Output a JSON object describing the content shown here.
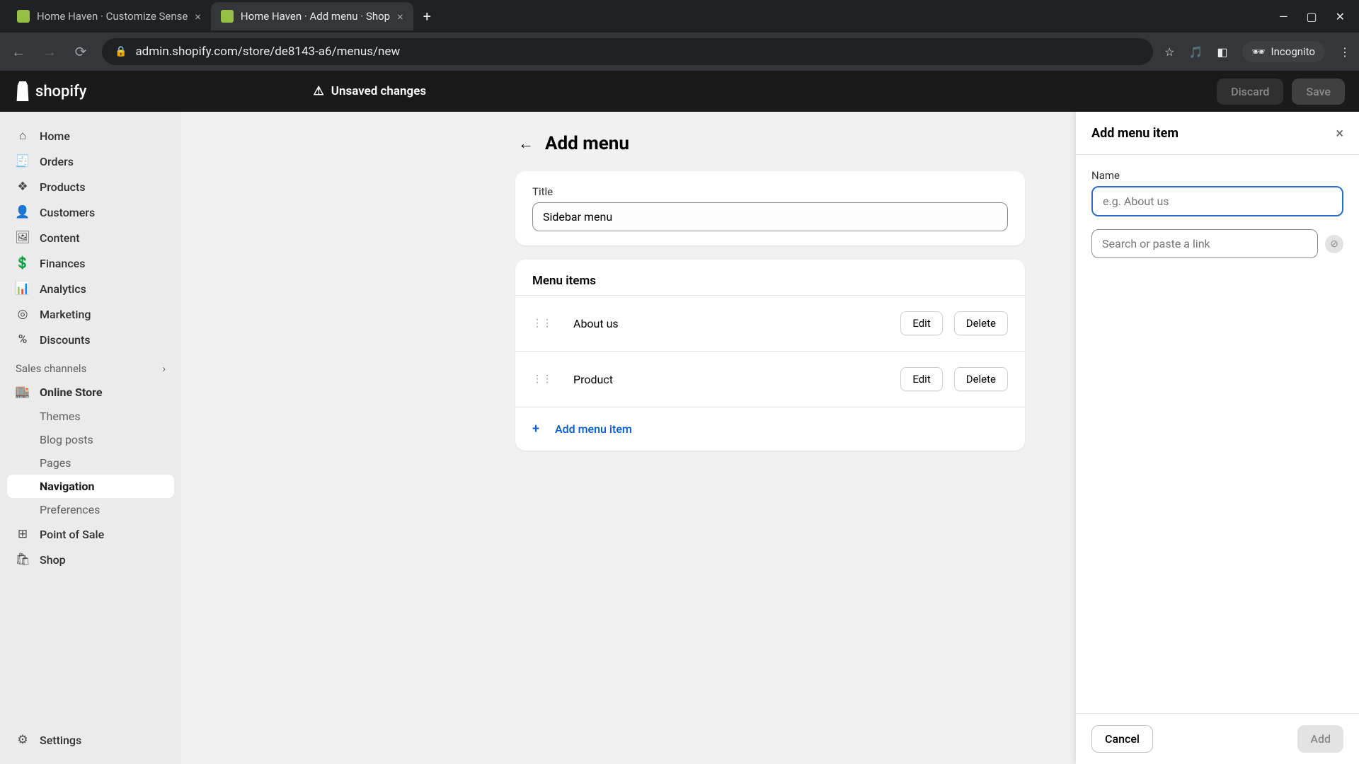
{
  "browser": {
    "tabs": [
      {
        "title": "Home Haven · Customize Sense"
      },
      {
        "title": "Home Haven · Add menu · Shop"
      }
    ],
    "url": "admin.shopify.com/store/de8143-a6/menus/new",
    "incognito_label": "Incognito"
  },
  "topbar": {
    "logo_text": "shopify",
    "unsaved_label": "Unsaved changes",
    "discard_label": "Discard",
    "save_label": "Save"
  },
  "sidebar": {
    "items": [
      {
        "label": "Home",
        "icon": "⌂"
      },
      {
        "label": "Orders",
        "icon": "🧾"
      },
      {
        "label": "Products",
        "icon": "❖"
      },
      {
        "label": "Customers",
        "icon": "👤"
      },
      {
        "label": "Content",
        "icon": "🖼"
      },
      {
        "label": "Finances",
        "icon": "💲"
      },
      {
        "label": "Analytics",
        "icon": "📊"
      },
      {
        "label": "Marketing",
        "icon": "◎"
      },
      {
        "label": "Discounts",
        "icon": "%"
      }
    ],
    "section_label": "Sales channels",
    "online_store_label": "Online Store",
    "sub_items": [
      {
        "label": "Themes"
      },
      {
        "label": "Blog posts"
      },
      {
        "label": "Pages"
      },
      {
        "label": "Navigation"
      },
      {
        "label": "Preferences"
      }
    ],
    "point_of_sale_label": "Point of Sale",
    "shop_label": "Shop",
    "settings_label": "Settings"
  },
  "page": {
    "title": "Add menu",
    "title_field_label": "Title",
    "title_field_value": "Sidebar menu",
    "menu_items_heading": "Menu items",
    "rows": [
      {
        "label": "About us"
      },
      {
        "label": "Product"
      }
    ],
    "edit_label": "Edit",
    "delete_label": "Delete",
    "add_item_label": "Add menu item"
  },
  "panel": {
    "title": "Add menu item",
    "name_label": "Name",
    "name_placeholder": "e.g. About us",
    "link_placeholder": "Search or paste a link",
    "cancel_label": "Cancel",
    "add_label": "Add"
  }
}
